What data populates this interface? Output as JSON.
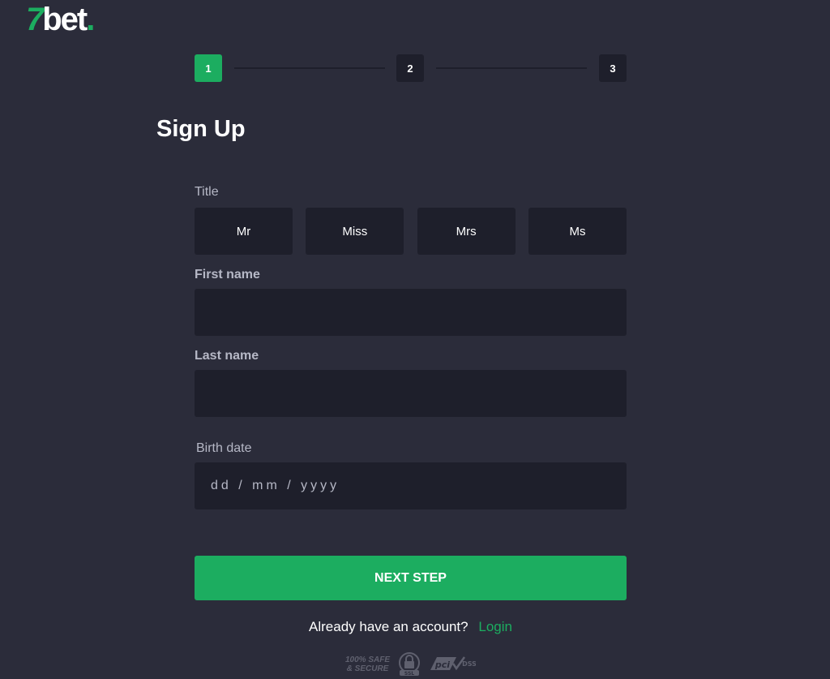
{
  "logo": {
    "seven": "7",
    "bet": "bet",
    "dot": "."
  },
  "stepper": {
    "steps": [
      "1",
      "2",
      "3"
    ],
    "current": 1
  },
  "page_title": "Sign Up",
  "form": {
    "title_label": "Title",
    "title_options": [
      "Mr",
      "Miss",
      "Mrs",
      "Ms"
    ],
    "first_name_label": "First name",
    "first_name_value": "",
    "last_name_label": "Last name",
    "last_name_value": "",
    "birth_date_label": "Birth date",
    "birth_date_placeholder": "dd / mm / yyyy"
  },
  "next_button_label": "NEXT STEP",
  "login_prompt": {
    "text": "Already have an account?",
    "link": "Login"
  },
  "badges": {
    "safe": "100% SAFE",
    "secure": "& SECURE",
    "ssl": "SSL",
    "pci": "pci",
    "dss": "DSS"
  },
  "colors": {
    "accent": "#1cad60",
    "background": "#2b2c3a",
    "field": "#1e1f2b"
  }
}
